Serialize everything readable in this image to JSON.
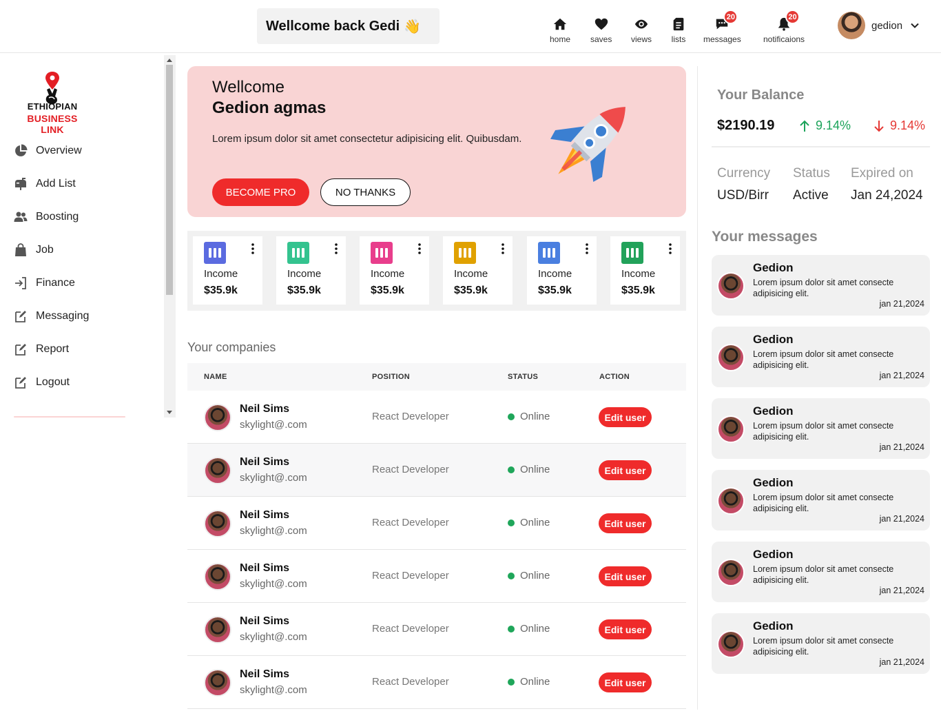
{
  "header": {
    "greeting": "Wellcome back Gedi",
    "wave_icon": "👋",
    "nav": [
      {
        "label": "home",
        "icon": "home-icon"
      },
      {
        "label": "saves",
        "icon": "heart-icon"
      },
      {
        "label": "views",
        "icon": "eye-icon"
      },
      {
        "label": "lists",
        "icon": "list-icon"
      },
      {
        "label": "messages",
        "icon": "chat-icon",
        "badge": "20"
      },
      {
        "label": "notificaions",
        "icon": "bell-icon",
        "badge": "20"
      }
    ],
    "username": "gedion"
  },
  "sidebar": {
    "logo_line1": "ETHIOPIAN",
    "logo_line2": "BUSINESS LINK",
    "items": [
      {
        "label": "Overview",
        "icon": "pie-chart-icon"
      },
      {
        "label": "Add List",
        "icon": "mailbox-icon"
      },
      {
        "label": "Boosting",
        "icon": "users-icon"
      },
      {
        "label": "Job",
        "icon": "shopping-bag-icon"
      },
      {
        "label": "Finance",
        "icon": "sign-in-icon"
      },
      {
        "label": "Messaging",
        "icon": "edit-icon"
      },
      {
        "label": "Report",
        "icon": "edit-icon"
      },
      {
        "label": "Logout",
        "icon": "edit-icon"
      }
    ]
  },
  "hero": {
    "greeting": "Wellcome",
    "name": "Gedion agmas",
    "description": "Lorem ipsum dolor sit amet consectetur adipisicing elit. Quibusdam.",
    "primary_button": "BECOME PRO",
    "secondary_button": "NO THANKS"
  },
  "stats": [
    {
      "label": "Income",
      "value": "$35.9k",
      "color": "#5b6be0"
    },
    {
      "label": "Income",
      "value": "$35.9k",
      "color": "#34c38f"
    },
    {
      "label": "Income",
      "value": "$35.9k",
      "color": "#e83e8c"
    },
    {
      "label": "Income",
      "value": "$35.9k",
      "color": "#e0a100"
    },
    {
      "label": "Income",
      "value": "$35.9k",
      "color": "#4a7fe0"
    },
    {
      "label": "Income",
      "value": "$35.9k",
      "color": "#22a25a"
    }
  ],
  "companies": {
    "title": "Your companies",
    "columns": [
      "NAME",
      "POSITION",
      "STATUS",
      "ACTION"
    ],
    "rows": [
      {
        "name": "Neil Sims",
        "email": "skylight@.com",
        "position": "React Developer",
        "status": "Online",
        "action": "Edit user"
      },
      {
        "name": "Neil Sims",
        "email": "skylight@.com",
        "position": "React Developer",
        "status": "Online",
        "action": "Edit user"
      },
      {
        "name": "Neil Sims",
        "email": "skylight@.com",
        "position": "React Developer",
        "status": "Online",
        "action": "Edit user"
      },
      {
        "name": "Neil Sims",
        "email": "skylight@.com",
        "position": "React Developer",
        "status": "Online",
        "action": "Edit user"
      },
      {
        "name": "Neil Sims",
        "email": "skylight@.com",
        "position": "React Developer",
        "status": "Online",
        "action": "Edit user"
      },
      {
        "name": "Neil Sims",
        "email": "skylight@.com",
        "position": "React Developer",
        "status": "Online",
        "action": "Edit user"
      }
    ]
  },
  "balance": {
    "title": "Your Balance",
    "amount": "$2190.19",
    "up_percent": "9.14%",
    "down_percent": "9.14%",
    "meta": [
      {
        "label": "Currency",
        "value": "USD/Birr"
      },
      {
        "label": "Status",
        "value": "Active"
      },
      {
        "label": "Expired on",
        "value": "Jan 24,2024"
      }
    ]
  },
  "messages": {
    "title": "Your messages",
    "items": [
      {
        "name": "Gedion",
        "text": "Lorem ipsum dolor sit amet consecte adipisicing elit.",
        "date": "jan 21,2024"
      },
      {
        "name": "Gedion",
        "text": "Lorem ipsum dolor sit amet consecte adipisicing elit.",
        "date": "jan 21,2024"
      },
      {
        "name": "Gedion",
        "text": "Lorem ipsum dolor sit amet consecte adipisicing elit.",
        "date": "jan 21,2024"
      },
      {
        "name": "Gedion",
        "text": "Lorem ipsum dolor sit amet consecte adipisicing elit.",
        "date": "jan 21,2024"
      },
      {
        "name": "Gedion",
        "text": "Lorem ipsum dolor sit amet consecte adipisicing elit.",
        "date": "jan 21,2024"
      },
      {
        "name": "Gedion",
        "text": "Lorem ipsum dolor sit amet consecte adipisicing elit.",
        "date": "jan 21,2024"
      }
    ]
  },
  "colors": {
    "accent": "#ef2b2b",
    "hero_bg": "#f9d4d4",
    "positive": "#1ba35a",
    "negative": "#e53935"
  }
}
